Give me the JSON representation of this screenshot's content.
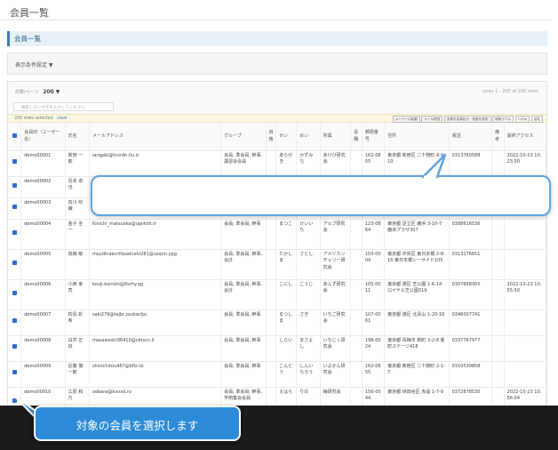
{
  "page": {
    "title": "会員一覧"
  },
  "section": {
    "title": "会員一覧"
  },
  "filter": {
    "label": "表示条件設定 ▼"
  },
  "list": {
    "per_page_label": "件数/ページ",
    "per_page_value": "200 ▼",
    "pagination": "‹prev 1 - 200 of 200 next›",
    "search_placeholder": "検索したい文字を入力してください",
    "selected_count": "200 rows selected",
    "clear_label": "clear",
    "actions": [
      "メーラーの起動",
      "メール配信",
      "会員を会員区分・役割を設定",
      "検索ラベル",
      "ハガキ",
      "名札"
    ]
  },
  "table": {
    "headers": [
      "会員ID（ユーザー名）",
      "氏名",
      "メールアドレス",
      "グループ",
      "資格",
      "せい",
      "めい",
      "所属",
      "役職",
      "郵便番号",
      "住所",
      "電話",
      "備考",
      "最終アクセス"
    ],
    "rows": [
      {
        "id": "demo00001",
        "name": "新田 一郎",
        "email": "iarigaki@tcvrdn.liu.ic",
        "group": "会員, 準会員, 幹事, 講習会会員",
        "sei": "あらがき",
        "mei": "かずみ ち",
        "affil": "あけび研究会",
        "zip": "162-0855",
        "addr": "東京都 新宿区 二十騎町 4-9-10",
        "tel": "0313760588",
        "access": "2022-10-23 10:23:50"
      },
      {
        "id": "demo00002",
        "name": "島本 卓也",
        "email": "",
        "group": "",
        "sei": "",
        "mei": "",
        "affil": "",
        "zip": "",
        "addr": "",
        "tel": "",
        "access": ""
      },
      {
        "id": "demo00003",
        "name": "石川 紗織",
        "email": "",
        "group": "",
        "sei": "",
        "mei": "",
        "affil": "",
        "zip": "",
        "addr": "",
        "tel": "",
        "access": ""
      },
      {
        "id": "demo00004",
        "name": "金子 圭一",
        "email": "Kinichi_matsuoka@ugvkttt.tr",
        "group": "会員, 準会員, 幹事",
        "sei": "まつこ",
        "mei": "けいいち",
        "affil": "アルプ研究会",
        "zip": "123-0864",
        "addr": "東京都 足立区 鹿浜 3-10-7 鹿浜プラザ307",
        "tel": "0388616536",
        "access": ""
      },
      {
        "id": "demo00005",
        "name": "高嶋 敏",
        "email": "mxydinaecrtfasatcehi281@usqnn.ypg",
        "group": "会員, 準会員, 幹事, 会計",
        "sei": "たかしま",
        "mei": "さとし",
        "affil": "アメリカンチェリー研究会",
        "zip": "103-0004",
        "addr": "東京都 中央区 東日本橋 2-8-16 東日本橋シーサイド105",
        "tel": "0313176651",
        "access": ""
      },
      {
        "id": "demo00006",
        "name": "小西 幸司",
        "email": "kouji.konishi@lfxrhy.qg",
        "group": "会員, 準会員, 幹事, 会計",
        "sei": "こにし",
        "mei": "こうじ",
        "affil": "あんず研究会",
        "zip": "105-0011",
        "addr": "東京都 港区 芝公園 1-6-14 ロイヤル芝公園319",
        "tel": "0307668305",
        "access": "2022-10-23 10:55:50"
      },
      {
        "id": "demo00007",
        "name": "松島 彩希",
        "email": "saki279@tajbr.zxukw.fpc",
        "group": "会員, 準会員, 幹事",
        "sei": "まつしま",
        "mei": "さき",
        "affil": "いちご研究会",
        "zip": "107-0061",
        "addr": "東京都 港区 北青山 1-20-16",
        "tel": "0346007741",
        "access": ""
      },
      {
        "id": "demo00008",
        "name": "白井 正好",
        "email": "masawoshi36410@cbtscn.ll",
        "group": "会員, 準会員, 幹事",
        "sei": "しらい",
        "mei": "まさよし",
        "affil": "いちじく研究会",
        "zip": "198-0024",
        "addr": "東京都 青梅市 新町 3-2-8 新町ステージ418",
        "tel": "0337767977",
        "access": ""
      },
      {
        "id": "demo00009",
        "name": "近藤 慎一郎",
        "email": "shinichirou467@bflz.iiz",
        "group": "会員, 準会員, 幹事",
        "sei": "こんどう",
        "mei": "しんいちろう",
        "affil": "いよかん研究会",
        "zip": "162-0855",
        "addr": "東京都 新宿区 二十騎町 2-1-7",
        "tel": "0310539858",
        "access": ""
      },
      {
        "id": "demo00010",
        "name": "江原 和乃",
        "email": "oebara@kxvxd.ro",
        "group": "会員, 準会員, 幹事, 学術集会会員",
        "sei": "えはら",
        "mei": "りの",
        "affil": "梅研究会",
        "zip": "156-0044",
        "addr": "東京都 世田谷区 赤堤 1-7-9",
        "tel": "0372878530",
        "access": "2022-10-23 10:56:04"
      }
    ]
  },
  "callout": {
    "text": "対象の会員を選択します"
  },
  "colors": {
    "accent": "#2d8bd7",
    "checkbox": "#2f6bd1",
    "section_bg": "#e7f0f7"
  }
}
